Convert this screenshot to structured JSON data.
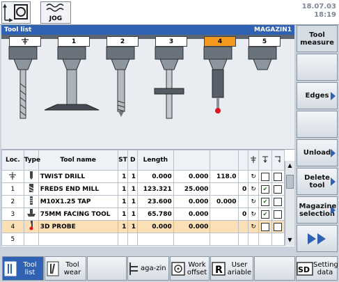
{
  "header": {
    "date": "18.07.03",
    "time": "18:19",
    "jog_label": "JOG"
  },
  "titlebar": {
    "title": "Tool list",
    "magazine": "MAGAZIN1"
  },
  "magazine": {
    "slots": [
      "1",
      "2",
      "3",
      "4",
      "5"
    ],
    "selected_slot": "4"
  },
  "table": {
    "headers": {
      "loc": "Loc.",
      "type": "Type",
      "name": "Tool name",
      "st": "ST",
      "d": "D",
      "length": "Length"
    },
    "rows": [
      {
        "loc": "",
        "name": "TWIST DRILL",
        "st": "1",
        "d": "1",
        "length": "0.000",
        "v2": "0.000",
        "v3": "118.0",
        "v4": "",
        "c1": false,
        "c2": false
      },
      {
        "loc": "1",
        "name": "FREDS END MILL",
        "st": "1",
        "d": "1",
        "length": "123.321",
        "v2": "25.000",
        "v3": "",
        "v4": "0",
        "c1": true,
        "c2": false
      },
      {
        "loc": "2",
        "name": "M10X1.25 TAP",
        "st": "1",
        "d": "1",
        "length": "23.600",
        "v2": "0.000",
        "v3": "0.000",
        "v4": "",
        "c1": true,
        "c2": false
      },
      {
        "loc": "3",
        "name": "75MM FACING TOOL",
        "st": "1",
        "d": "1",
        "length": "65.780",
        "v2": "0.000",
        "v3": "",
        "v4": "0",
        "c1": true,
        "c2": false
      },
      {
        "loc": "4",
        "name": "3D PROBE",
        "st": "1",
        "d": "1",
        "length": "0.000",
        "v2": "0.000",
        "v3": "",
        "v4": "",
        "c1": false,
        "c2": false
      },
      {
        "loc": "5",
        "name": "",
        "st": "",
        "d": "",
        "length": "",
        "v2": "",
        "v3": "",
        "v4": "",
        "c1": null,
        "c2": null
      }
    ]
  },
  "softkeys_right": {
    "tool_measure": "Tool measure",
    "edges": "Edges",
    "unload": "Unload",
    "delete_tool": "Delete tool",
    "magazine_selection": "Magazine selection"
  },
  "softkeys_bottom": {
    "tool_list": "Tool list",
    "tool_wear": "Tool wear",
    "magazine": "aga-zin",
    "work_offset": "Work offset",
    "user_variable": "User ariable",
    "setting_data": "Setting data"
  },
  "colors": {
    "accent": "#2f62b3",
    "selected_slot": "#f39a1e",
    "selected_row": "#fbe0b5"
  }
}
